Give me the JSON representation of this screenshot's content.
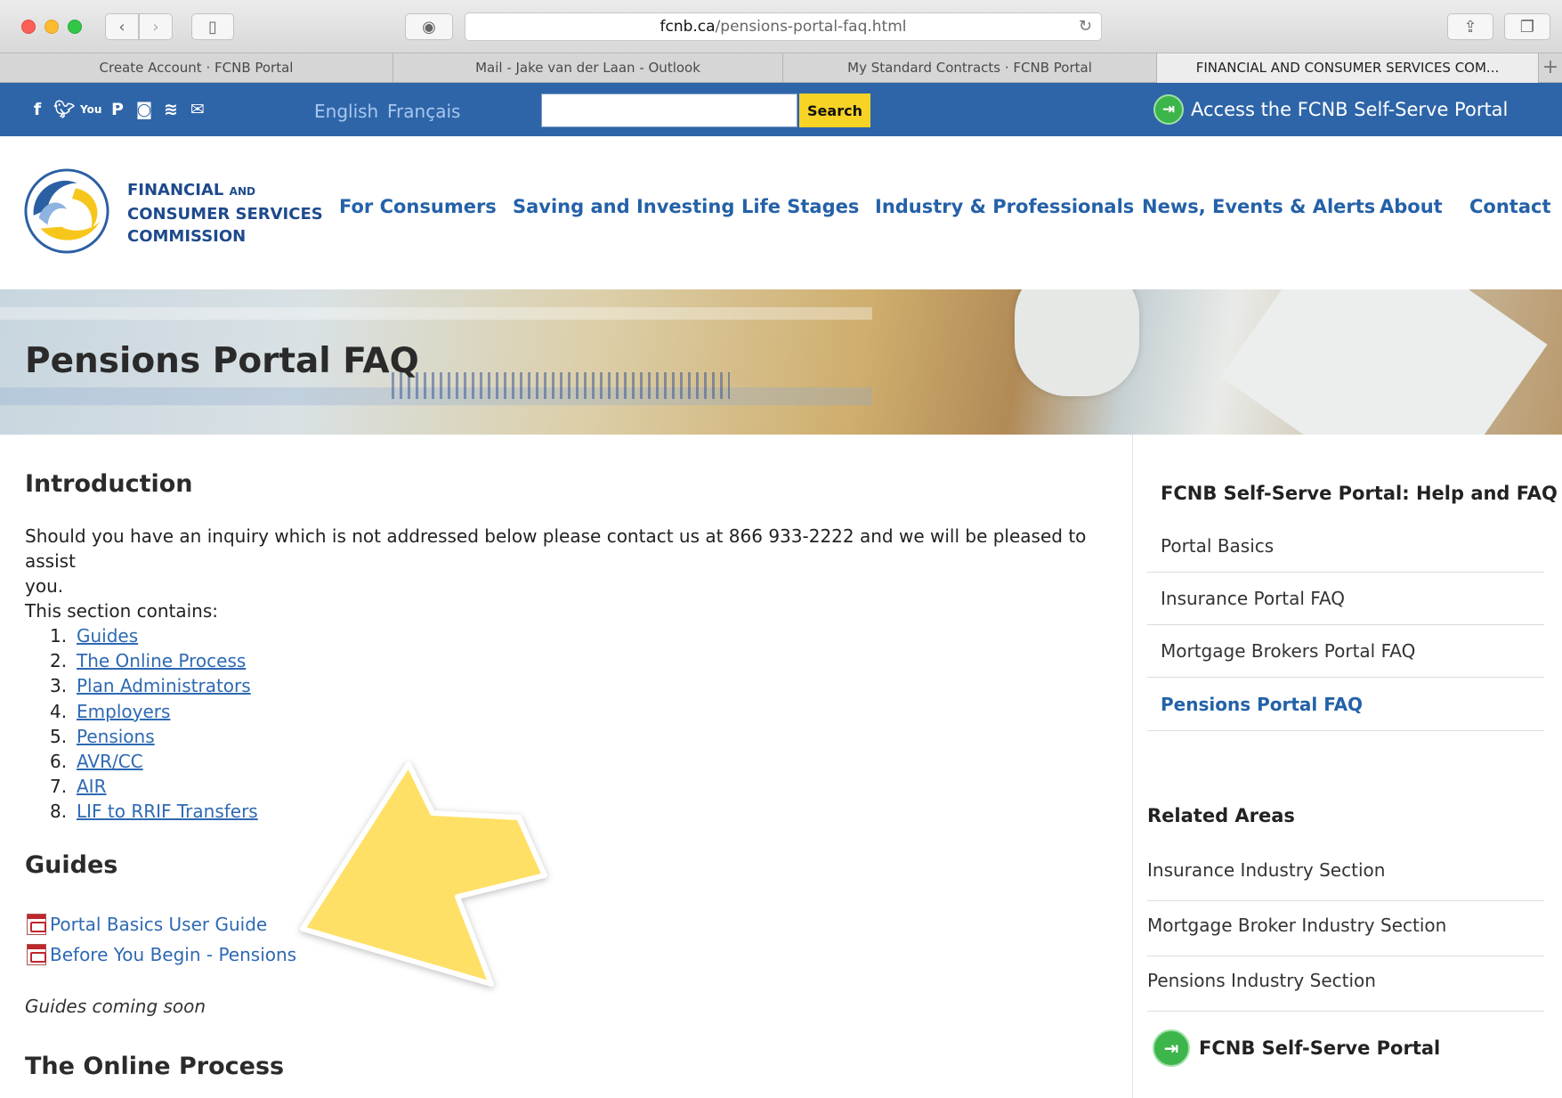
{
  "browser": {
    "url_domain": "fcnb.ca",
    "url_path": "/pensions-portal-faq.html",
    "tabs": [
      {
        "label": "Create Account · FCNB Portal",
        "active": false
      },
      {
        "label": "Mail - Jake van der Laan - Outlook",
        "active": false
      },
      {
        "label": "My Standard Contracts · FCNB Portal",
        "active": false
      },
      {
        "label": "FINANCIAL AND CONSUMER SERVICES COM...",
        "active": true
      }
    ]
  },
  "topbar": {
    "social_icons": [
      "facebook-icon",
      "twitter-icon",
      "youtube-icon",
      "pinterest-icon",
      "instagram-icon",
      "rss-icon",
      "email-icon"
    ],
    "lang_en": "English",
    "lang_fr": "Français",
    "search_value": "",
    "search_button": "Search",
    "portal_link": "Access the FCNB Self-Serve Portal"
  },
  "logo": {
    "line1": "FINANCIAL",
    "line1_small": "AND",
    "line2": "CONSUMER SERVICES",
    "line3": "COMMISSION"
  },
  "nav": [
    "For Consumers",
    "Saving and Investing",
    "Life Stages",
    "Industry & Professionals",
    "News, Events & Alerts",
    "About",
    "Contact"
  ],
  "hero": {
    "title": "Pensions Portal FAQ"
  },
  "main": {
    "intro_heading": "Introduction",
    "intro_text_1": "Should you have an inquiry which is not addressed below please contact us at 866 933-2222 and we will be pleased to assist",
    "intro_text_2": "you.",
    "section_contains": "This section contains:",
    "toc": [
      {
        "num": "1.",
        "label": "Guides"
      },
      {
        "num": "2.",
        "label": "The Online Process"
      },
      {
        "num": "3.",
        "label": "Plan Administrators"
      },
      {
        "num": "4.",
        "label": "Employers"
      },
      {
        "num": "5.",
        "label": "Pensions"
      },
      {
        "num": "6.",
        "label": "AVR/CC"
      },
      {
        "num": "7.",
        "label": "AIR"
      },
      {
        "num": "8.",
        "label": "LIF to RRIF Transfers"
      }
    ],
    "guides_heading": "Guides",
    "guides": [
      "Portal Basics User Guide",
      "Before You Begin - Pensions"
    ],
    "guides_note": "Guides coming soon",
    "online_heading": "The Online Process"
  },
  "sidebar": {
    "heading": "FCNB Self-Serve Portal: Help and FAQ",
    "items": [
      {
        "label": "Portal Basics",
        "active": false
      },
      {
        "label": "Insurance Portal FAQ",
        "active": false
      },
      {
        "label": "Mortgage Brokers Portal FAQ",
        "active": false
      },
      {
        "label": "Pensions Portal FAQ",
        "active": true
      }
    ],
    "related_heading": "Related Areas",
    "related": [
      "Insurance Industry Section",
      "Mortgage Broker Industry Section",
      "Pensions Industry Section"
    ],
    "portal_label": "FCNB Self-Serve Portal"
  },
  "colors": {
    "topbar": "#2e65a8",
    "nav_link": "#2461a8",
    "link": "#2e69b3",
    "search_button": "#f6d325",
    "annotation_arrow": "#ffe066"
  }
}
